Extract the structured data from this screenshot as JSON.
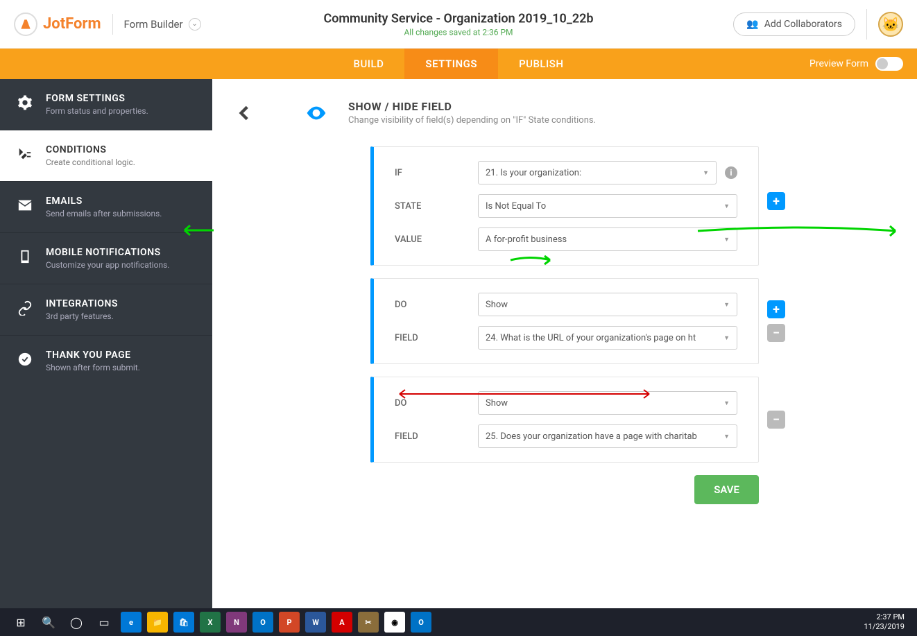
{
  "header": {
    "logo_text": "JotForm",
    "form_builder_label": "Form Builder",
    "title": "Community Service - Organization 2019_10_22b",
    "save_status": "All changes saved at 2:36 PM",
    "add_collab": "Add Collaborators"
  },
  "nav": {
    "tabs": [
      "BUILD",
      "SETTINGS",
      "PUBLISH"
    ],
    "preview_label": "Preview Form"
  },
  "sidebar": {
    "items": [
      {
        "title": "FORM SETTINGS",
        "sub": "Form status and properties."
      },
      {
        "title": "CONDITIONS",
        "sub": "Create conditional logic."
      },
      {
        "title": "EMAILS",
        "sub": "Send emails after submissions."
      },
      {
        "title": "MOBILE NOTIFICATIONS",
        "sub": "Customize your app notifications."
      },
      {
        "title": "INTEGRATIONS",
        "sub": "3rd party features."
      },
      {
        "title": "THANK YOU PAGE",
        "sub": "Shown after form submit."
      }
    ]
  },
  "content": {
    "page_title": "SHOW / HIDE FIELD",
    "page_sub": "Change visibility of field(s) depending on \"IF\" State conditions.",
    "card1": {
      "labels": {
        "if": "IF",
        "state": "STATE",
        "value": "VALUE"
      },
      "if_val": "21. Is your organization:",
      "state_val": "Is Not Equal To",
      "value_val": "A for-profit business"
    },
    "card2": {
      "labels": {
        "do": "DO",
        "field": "FIELD"
      },
      "do_val": "Show",
      "field_val": "24. What is the URL of your organization's page on ht"
    },
    "card3": {
      "labels": {
        "do": "DO",
        "field": "FIELD"
      },
      "do_val": "Show",
      "field_val": "25. Does your organization have a page with charitab"
    },
    "save_label": "SAVE"
  },
  "taskbar": {
    "time": "2:37 PM",
    "date": "11/23/2019"
  }
}
